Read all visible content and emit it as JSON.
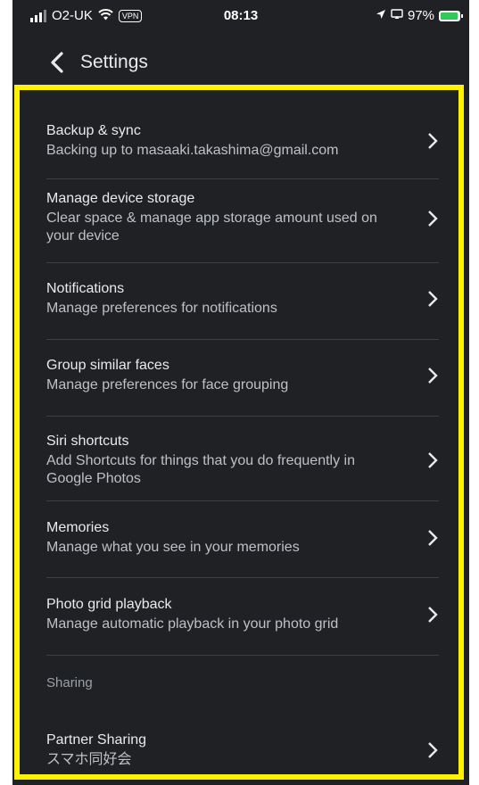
{
  "status_bar": {
    "carrier": "O2-UK",
    "vpn": "VPN",
    "time": "08:13",
    "battery": "97%",
    "battery_level": 0.97
  },
  "header": {
    "title": "Settings"
  },
  "settings": [
    {
      "title": "Backup & sync",
      "subtitle": "Backing up to masaaki.takashima@gmail.com"
    },
    {
      "title": "Manage device storage",
      "subtitle": "Clear space & manage app storage amount used on your device"
    },
    {
      "title": "Notifications",
      "subtitle": "Manage preferences for notifications"
    },
    {
      "title": "Group similar faces",
      "subtitle": "Manage preferences for face grouping"
    },
    {
      "title": "Siri shortcuts",
      "subtitle": "Add Shortcuts for things that you do frequently in Google Photos"
    },
    {
      "title": "Memories",
      "subtitle": "Manage what you see in your memories"
    },
    {
      "title": "Photo grid playback",
      "subtitle": "Manage automatic playback in your photo grid"
    }
  ],
  "sharing": {
    "section_label": "Sharing",
    "items": [
      {
        "title": "Partner Sharing",
        "subtitle": "スマホ同好会"
      }
    ]
  },
  "colors": {
    "background": "#202124",
    "highlight": "#fff200",
    "text_primary": "#e8eaed",
    "text_secondary": "#bdc1c6",
    "divider": "#3c4043"
  }
}
